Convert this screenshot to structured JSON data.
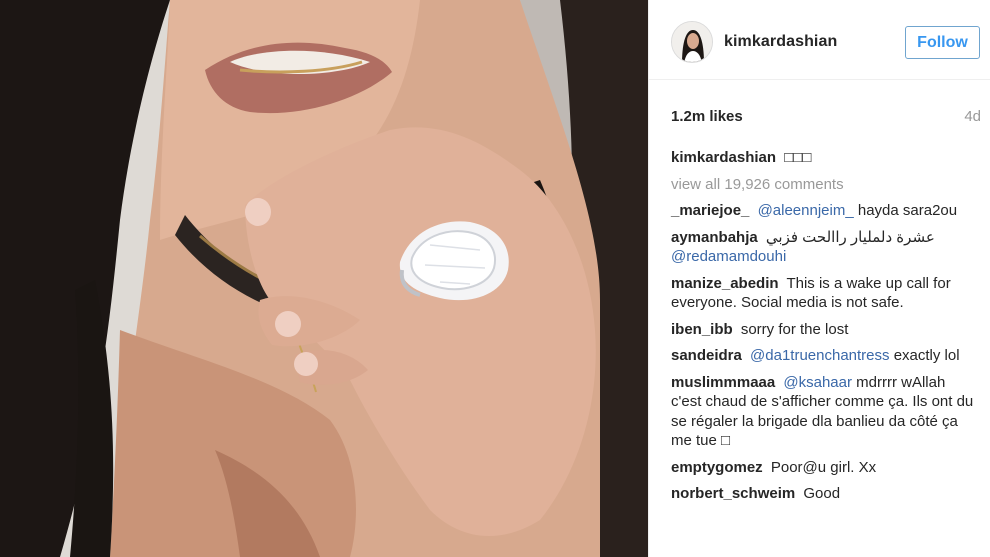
{
  "post": {
    "username": "kimkardashian",
    "follow_label": "Follow",
    "likes": "1.2m likes",
    "age": "4d",
    "caption": {
      "user": "kimkardashian",
      "text": "□□□"
    },
    "view_all": "view all 19,926 comments",
    "comments": [
      {
        "user": "_mariejoe_",
        "mention": "@aleennjeim_",
        "text": "hayda sara2ou"
      },
      {
        "user": "aymanbahja",
        "mention": "",
        "text": "عشرة دلمليار راالحت فزبي",
        "mention_after": "@redamamdouhi"
      },
      {
        "user": "manize_abedin",
        "mention": "",
        "text": "This is a wake up call for everyone. Social media is not safe."
      },
      {
        "user": "iben_ibb",
        "mention": "",
        "text": "sorry for the lost"
      },
      {
        "user": "sandeidra",
        "mention": "@da1truenchantress",
        "text": "exactly lol"
      },
      {
        "user": "muslimmmaaa",
        "mention": "@ksahaar",
        "text": "mdrrrr wAllah c'est chaud de s'afficher comme ça. Ils ont du se régaler la brigade dla banlieu da côté ça me tue □"
      },
      {
        "user": "emptygomez",
        "mention": "",
        "text": "Poor@u girl. Xx"
      },
      {
        "user": "norbert_schweim",
        "mention": "",
        "text": "Good"
      }
    ]
  },
  "colors": {
    "link": "#3897f0",
    "mention": "#3a68a8",
    "muted": "#999999",
    "text": "#262626"
  },
  "icons": {
    "avatar": "profile-photo"
  }
}
